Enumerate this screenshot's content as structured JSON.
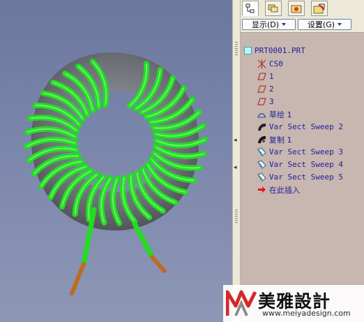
{
  "colors": {
    "viewport_bg": "#7a86aa",
    "coil_wire": "#22dd22",
    "core": "#6f7278",
    "lead_copper": "#c06a22",
    "tree_text": "#1e1e9c",
    "panel_bg": "#c8b6b0"
  },
  "tabs": [
    {
      "icon": "model-tree-icon"
    },
    {
      "icon": "layers-icon"
    },
    {
      "icon": "folder-browser-icon"
    },
    {
      "icon": "favorites-icon"
    }
  ],
  "toolbar": {
    "show_label": "显示(D)",
    "settings_label": "设置(G)"
  },
  "tree": {
    "root": "PRT0001.PRT",
    "items": [
      {
        "icon": "coordinate-system-icon",
        "label": "CS0"
      },
      {
        "icon": "datum-plane-icon",
        "label": "1"
      },
      {
        "icon": "datum-plane-icon",
        "label": "2"
      },
      {
        "icon": "datum-plane-icon",
        "label": "3"
      },
      {
        "icon": "sketch-icon",
        "label": "草绘 1"
      },
      {
        "icon": "sweep-icon",
        "label": "Var Sect Sweep 2"
      },
      {
        "icon": "copy-feature-icon",
        "label": "复制 1"
      },
      {
        "icon": "sweep-icon",
        "label": "Var Sect Sweep 3"
      },
      {
        "icon": "sweep-icon",
        "label": "Var Sect Sweep 4"
      },
      {
        "icon": "sweep-icon",
        "label": "Var Sect Sweep 5"
      },
      {
        "icon": "insert-here-arrow-icon",
        "label": "在此插入"
      }
    ]
  },
  "watermark": {
    "text": "美雅設計",
    "url": "www.meiyadesign.com"
  }
}
